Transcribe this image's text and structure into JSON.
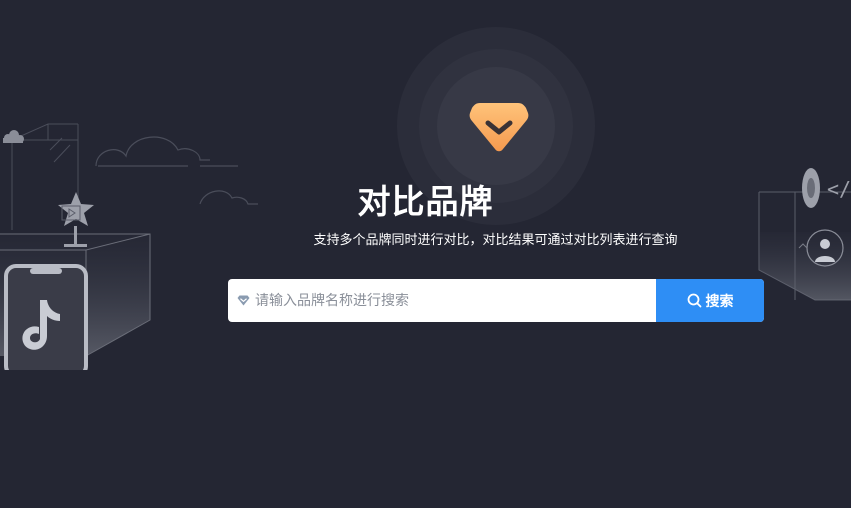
{
  "hero": {
    "title": "对比品牌",
    "subtitle": "支持多个品牌同时进行对比，对比结果可通过对比列表进行查询"
  },
  "search": {
    "placeholder": "请输入品牌名称进行搜索",
    "value": "",
    "button_label": "搜索"
  },
  "colors": {
    "background": "#242633",
    "accent": "#2e8ef5",
    "logo_gradient_start": "#ffc37a",
    "logo_gradient_end": "#f59a4f"
  },
  "icons": {
    "logo": "diamond-chevron-icon",
    "search": "search-icon",
    "input_prefix": "diamond-icon"
  }
}
